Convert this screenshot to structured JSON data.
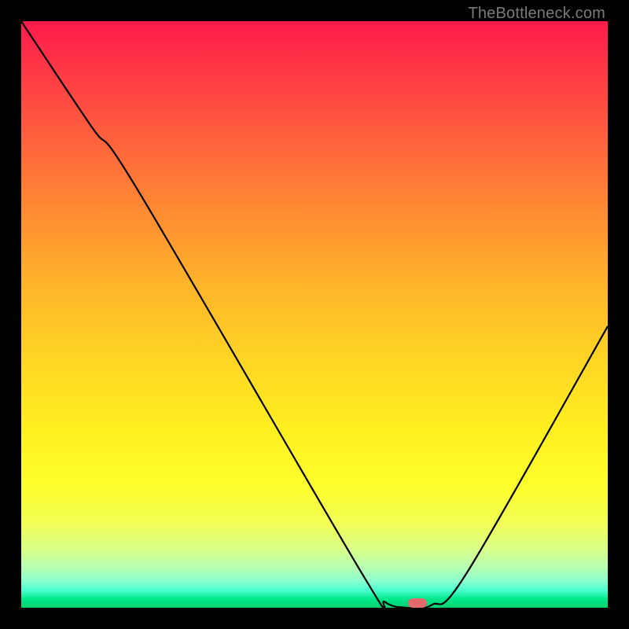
{
  "watermark": "TheBottleneck.com",
  "chart_data": {
    "type": "line",
    "title": "",
    "xlabel": "",
    "ylabel": "",
    "xlim": [
      0,
      100
    ],
    "ylim": [
      0,
      100
    ],
    "curve": [
      {
        "x": 0,
        "y": 100
      },
      {
        "x": 12,
        "y": 82
      },
      {
        "x": 20,
        "y": 71
      },
      {
        "x": 58,
        "y": 6
      },
      {
        "x": 62,
        "y": 1
      },
      {
        "x": 66,
        "y": 0
      },
      {
        "x": 70,
        "y": 0.5
      },
      {
        "x": 76,
        "y": 6
      },
      {
        "x": 100,
        "y": 48
      }
    ],
    "marker": {
      "x": 67.5,
      "y": 0.8,
      "color": "#e26a6a"
    },
    "background": {
      "type": "vertical-gradient",
      "stops": [
        {
          "pos": 0,
          "color": "#ff1a4d"
        },
        {
          "pos": 0.5,
          "color": "#ffd624"
        },
        {
          "pos": 0.8,
          "color": "#fdff2e"
        },
        {
          "pos": 1.0,
          "color": "#00d070"
        }
      ]
    }
  }
}
